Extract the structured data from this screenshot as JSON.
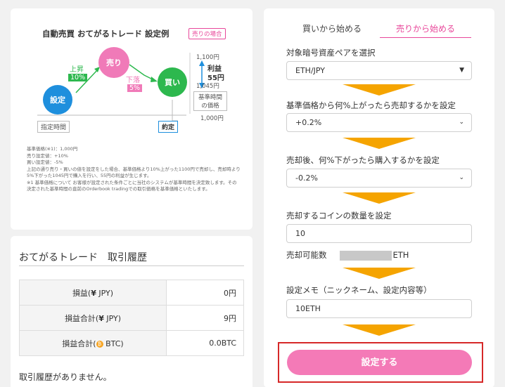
{
  "diagram": {
    "title": "自動売買 おてがるトレード 設定例",
    "tag": "売りの場合",
    "node_set": "設定",
    "node_sell": "売り",
    "node_buy": "買い",
    "rise_label": "上昇",
    "rise_pct": "10%",
    "fall_label": "下落",
    "fall_pct": "5%",
    "price_high": "1,100円",
    "profit_label": "利益",
    "profit_value": "55円",
    "price_mid": "1,045円",
    "base_price_label": "基準時間\nの価格",
    "price_low": "1,000円",
    "designated_time": "指定時間",
    "executed": "約定",
    "notes": [
      "基準価格(※1)：1,000円",
      "売り設定値：+10%",
      "買い設定値：-5%",
      "上記の通り売り・買いの値を設定をした場合、基準価格より10%上がった1100円で売却し、売却時より5%下がった1045円で購入を行い、55円の利益が生じます。",
      "※1 基準価格について お客様が設定された条件ごとに当社のシステムが基準時間を決定致します。その決定された基準時間の直前のOrderbook tradingでの取引価格を基準価格といたします。"
    ],
    "colors": {
      "blue": "#1e8fdd",
      "pink": "#f07ab8",
      "green": "#2db84e"
    }
  },
  "history": {
    "title": "おてがるトレード　取引履歴",
    "rows": [
      {
        "label_pre": "損益(",
        "currency_icon": "yen-icon",
        "currency_symbol": "¥",
        "label_post": " JPY)",
        "value": "0円"
      },
      {
        "label_pre": "損益合計(",
        "currency_icon": "yen-icon",
        "currency_symbol": "¥",
        "label_post": " JPY)",
        "value": "9円"
      },
      {
        "label_pre": "損益合計(",
        "currency_icon": "bitcoin-icon",
        "currency_symbol": "₿",
        "label_post": " BTC)",
        "value": "0.0BTC"
      }
    ],
    "empty_message": "取引履歴がありません。"
  },
  "settings": {
    "tab_buy": "買いから始める",
    "tab_sell": "売りから始める",
    "pair_label": "対象暗号資産ペアを選択",
    "pair_value": "ETH/JPY",
    "sell_pct_label": "基準価格から何%上がったら売却するかを設定",
    "sell_pct_value": "+0.2%",
    "buy_pct_label": "売却後、何%下がったら購入するかを設定",
    "buy_pct_value": "-0.2%",
    "qty_label": "売却するコインの数量を設定",
    "qty_value": "10",
    "available_label": "売却可能数",
    "available_unit": "ETH",
    "memo_label": "設定メモ（ニックネーム、設定内容等）",
    "memo_value": "10ETH",
    "submit_label": "設定する",
    "accent_color": "#e8479a",
    "arrow_color": "#f5a400",
    "button_color": "#f47ab7",
    "highlight_color": "#d62828"
  }
}
